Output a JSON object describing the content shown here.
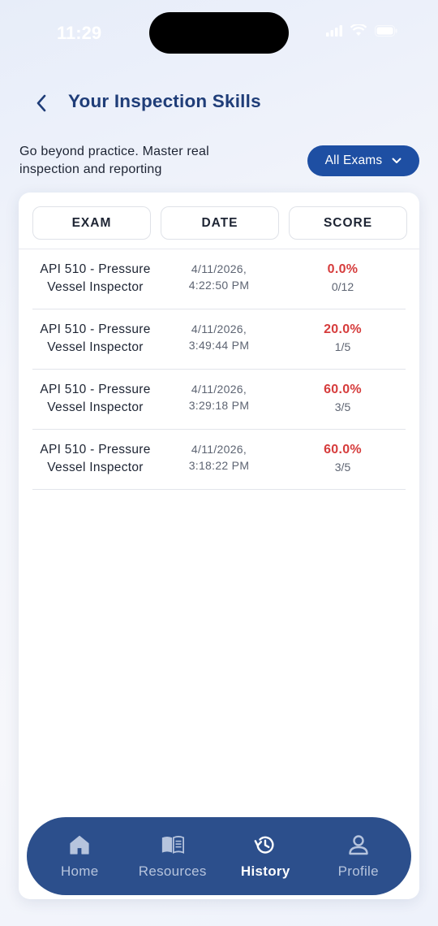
{
  "status_bar": {
    "time": "11:29"
  },
  "header": {
    "title": "Your Inspection Skills"
  },
  "tagline": "Go beyond practice. Master real inspection and reporting",
  "filter": {
    "label": "All Exams"
  },
  "table": {
    "columns": [
      "EXAM",
      "DATE",
      "SCORE"
    ],
    "rows": [
      {
        "exam": "API 510 - Pressure Vessel Inspector",
        "date_line1": "4/11/2026,",
        "date_line2": "4:22:50 PM",
        "score": "0.0%",
        "fraction": "0/12"
      },
      {
        "exam": "API 510 - Pressure Vessel Inspector",
        "date_line1": "4/11/2026,",
        "date_line2": "3:49:44 PM",
        "score": "20.0%",
        "fraction": "1/5"
      },
      {
        "exam": "API 510 - Pressure Vessel Inspector",
        "date_line1": "4/11/2026,",
        "date_line2": "3:29:18 PM",
        "score": "60.0%",
        "fraction": "3/5"
      },
      {
        "exam": "API 510 - Pressure Vessel Inspector",
        "date_line1": "4/11/2026,",
        "date_line2": "3:18:22 PM",
        "score": "60.0%",
        "fraction": "3/5"
      }
    ]
  },
  "tabbar": {
    "tabs": [
      {
        "label": "Home",
        "icon": "home-icon",
        "active": false
      },
      {
        "label": "Resources",
        "icon": "book-icon",
        "active": false
      },
      {
        "label": "History",
        "icon": "history-icon",
        "active": true
      },
      {
        "label": "Profile",
        "icon": "profile-icon",
        "active": false
      }
    ]
  },
  "colors": {
    "primary": "#1e4fa3",
    "title": "#1f3d78",
    "tabbar": "#2c4f8c",
    "score_red": "#d63c3c"
  }
}
